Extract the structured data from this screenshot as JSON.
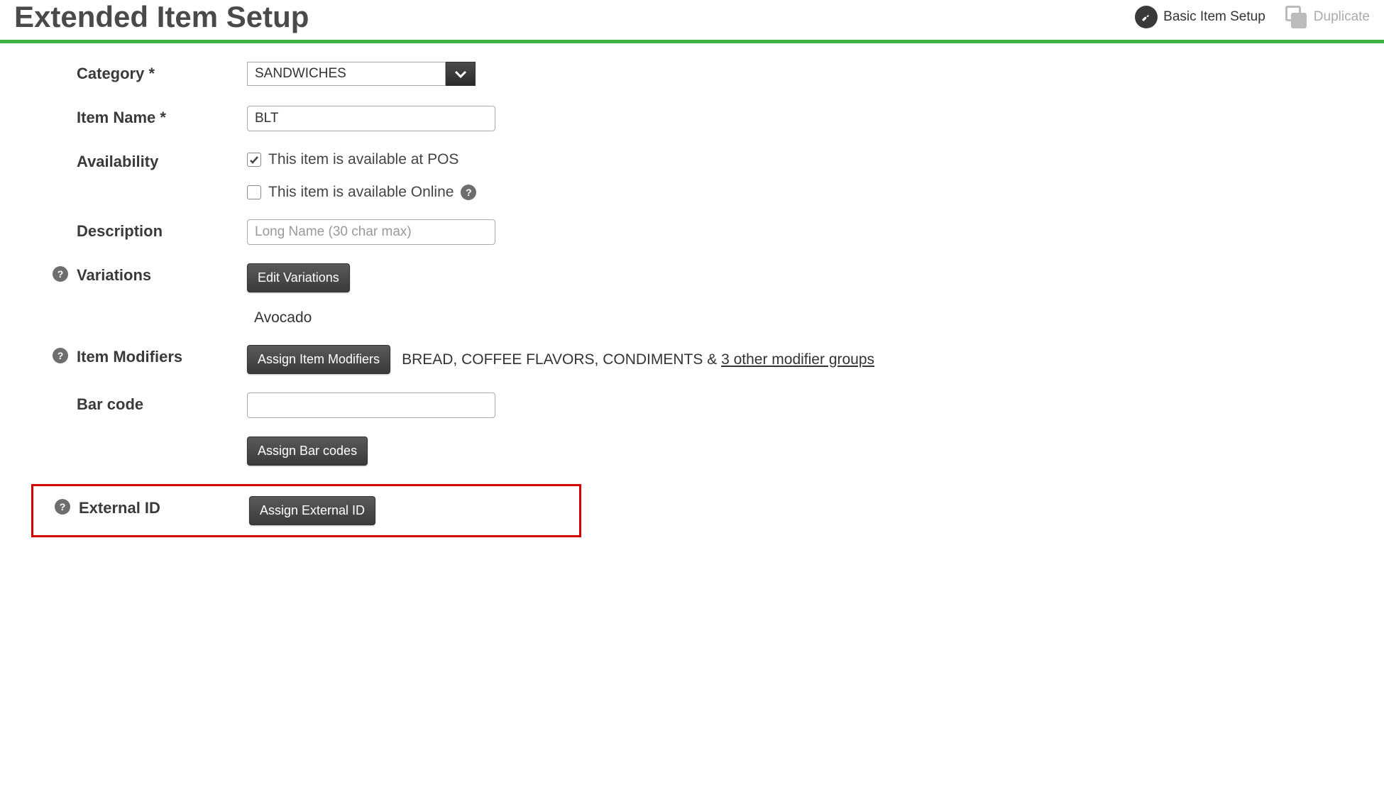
{
  "header": {
    "title": "Extended Item Setup",
    "actions": {
      "basic_setup": "Basic Item Setup",
      "duplicate": "Duplicate"
    }
  },
  "form": {
    "category": {
      "label": "Category *",
      "value": "SANDWICHES"
    },
    "item_name": {
      "label": "Item Name *",
      "value": "BLT"
    },
    "availability": {
      "label": "Availability",
      "pos": {
        "label": "This item is available at POS",
        "checked": true
      },
      "online": {
        "label": "This item is available Online",
        "checked": false
      }
    },
    "description": {
      "label": "Description",
      "placeholder": "Long Name (30 char max)",
      "value": ""
    },
    "variations": {
      "label": "Variations",
      "button": "Edit Variations",
      "items": [
        "Avocado"
      ]
    },
    "item_modifiers": {
      "label": "Item Modifiers",
      "button": "Assign Item Modifiers",
      "summary_prefix": "BREAD, COFFEE FLAVORS, CONDIMENTS & ",
      "summary_link": "3 other modifier groups"
    },
    "barcode": {
      "label": "Bar code",
      "value": "",
      "button": "Assign Bar codes"
    },
    "external_id": {
      "label": "External ID",
      "button": "Assign External ID"
    }
  }
}
